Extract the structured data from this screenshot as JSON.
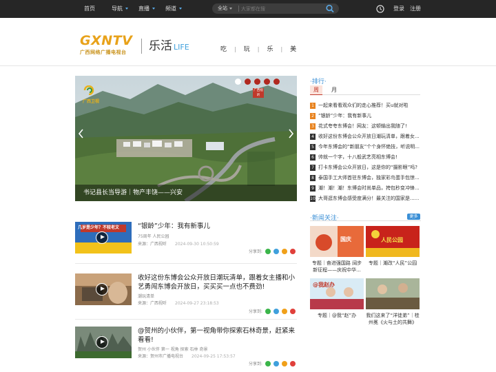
{
  "topbar": {
    "nav": [
      "首页",
      "导航",
      "直播",
      "频道"
    ],
    "search_scope": "全站",
    "search_placeholder": "大家都在搜",
    "login": "登录",
    "register": "注册"
  },
  "header": {
    "logo_big": "GXNTV",
    "logo_small": "广西网络广播电视台",
    "brand_cn": "乐活",
    "brand_en": "LIFE",
    "categories": [
      "吃",
      "玩",
      "乐",
      "美"
    ]
  },
  "hero": {
    "caption": "书记县长当导游｜物产丰饶——兴安",
    "slide_count": 5,
    "active_slide": 1,
    "channel_badge": "广西卫视",
    "corner_label": "广西视听"
  },
  "articles": [
    {
      "title": "“银龄”少年：我有新事儿",
      "tags": "75周年 人民公园",
      "source": "来源：广西视听",
      "date": "2024-09-30 10:50:59",
      "share_label": "分享到:",
      "thumb_text": "几岁是少年？不较老文"
    },
    {
      "title": "收好这份东博会公众开放日潮玩清单，跟着女主播和小艺勇闯东博会开放日，买买买一点也不费劲!",
      "tags": "潮玩清单",
      "source": "来源：广西视听",
      "date": "2024-09-27 23:18:53",
      "share_label": "分享到:"
    },
    {
      "title": "@贺州的小伙伴，第一视角带你探索石林奇景，赶紧来看看!",
      "tags": "贺州 小伙伴 第一 视角 探索 石林 奇景",
      "source": "来源：贺州市广播电视台",
      "date": "2024-09-25 17:53:57",
      "share_label": "分享到:"
    }
  ],
  "ranking": {
    "title": "排行",
    "tabs": [
      "周",
      "月"
    ],
    "active_tab": "周",
    "items": [
      "一起来看看观众们的走心推荐！买u就对啦",
      "“银龄”少年：我有新事儿",
      "花式夸夸东博会！网友：这顿输出我随了!",
      "收好这份东博会公众开放日潮玩清单，跟着女...",
      "今年东博会的“新朋友”个个身怀绝技，听说明...",
      "帅就一个字，十八般武艺亮相东博会!",
      "打卡东博会公众开放日，这是你的“摄影眼”吗?",
      "泰国手工大师首驻东博会，独家彩鸟蛋手包惊...",
      "潮！潮！潮！东博会时尚单品，挎包秒变冲锋...",
      "大哥逛东博会感受度满分！最关注的国家是......"
    ]
  },
  "focus": {
    "title": "新闻关注",
    "more": "更多",
    "cards": [
      {
        "caption": "专题｜奋进强国路 阔步新征程——庆祝中华...",
        "img_text": "国庆"
      },
      {
        "caption": "专题｜潮改“人民”公园",
        "img_text": "人民公园"
      },
      {
        "caption": "专题｜@我“赵”办",
        "img_text": "@我赵办"
      },
      {
        "caption": "我们这来了“洋徒弟”｜桂州冕《火与土的共舞》",
        "img_text": ""
      }
    ]
  },
  "colors": {
    "accent_blue": "#3a8fd6",
    "rank_top": "#e8831f",
    "topbar_bg": "#262626",
    "logo_gold": "#e8a21a"
  }
}
